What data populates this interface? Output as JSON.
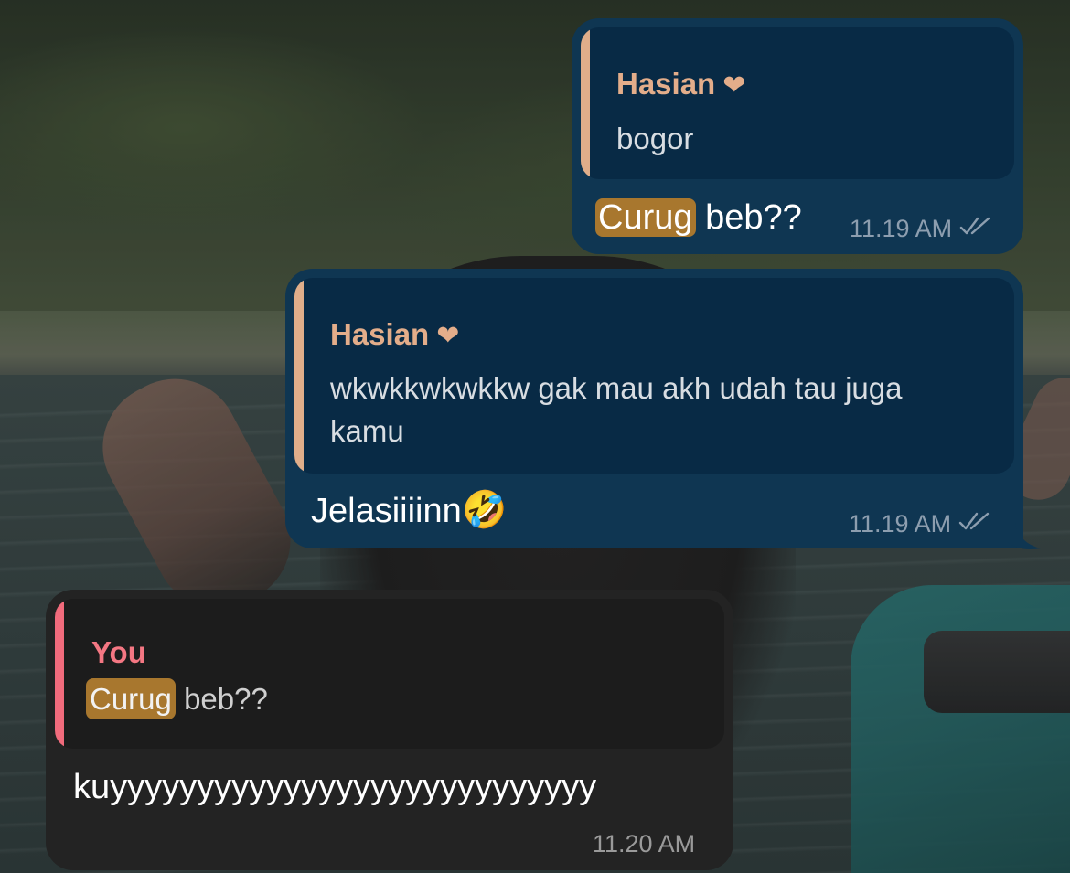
{
  "messages": [
    {
      "direction": "outgoing",
      "reply_to": {
        "name": "Hasian",
        "icon": "heart-icon",
        "text": "bogor"
      },
      "highlight": "Curug",
      "text": "beb??",
      "time": "11.19 AM",
      "status": "read"
    },
    {
      "direction": "outgoing",
      "reply_to": {
        "name": "Hasian",
        "icon": "heart-icon",
        "text_line1": "wkwkkwkwkkw gak mau akh udah tau juga",
        "text_line2": "kamu"
      },
      "text": "Jelasiiiinn",
      "emoji": "🤣",
      "time": "11.19 AM",
      "status": "read"
    },
    {
      "direction": "incoming",
      "reply_to": {
        "name": "You",
        "highlight": "Curug",
        "text": "beb??"
      },
      "text": "kuyyyyyyyyyyyyyyyyyyyyyyyyyyyy",
      "time": "11.20 AM"
    }
  ],
  "colors": {
    "outgoing_bubble": "#0f3652",
    "incoming_bubble": "#232323",
    "reply_accent_peach": "#e0ae8a",
    "reply_accent_pink": "#f16b7c",
    "search_highlight": "#a8772e"
  }
}
